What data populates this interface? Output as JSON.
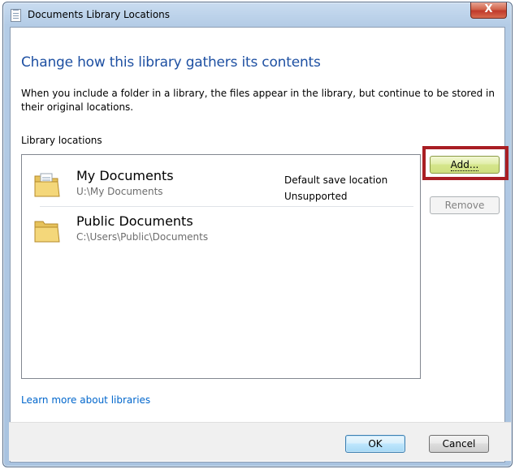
{
  "window": {
    "title": "Documents Library Locations",
    "close_label": "X"
  },
  "heading": "Change how this library gathers its contents",
  "description": "When you include a folder in a library, the files appear in the library, but continue to be stored in their original locations.",
  "section_label": "Library locations",
  "locations": [
    {
      "name": "My Documents",
      "path": "U:\\My Documents",
      "status_line1": "Default save location",
      "status_line2": "Unsupported",
      "icon": "documents-folder-icon"
    },
    {
      "name": "Public Documents",
      "path": "C:\\Users\\Public\\Documents",
      "icon": "folder-icon"
    }
  ],
  "buttons": {
    "add": "Add...",
    "remove": "Remove",
    "ok": "OK",
    "cancel": "Cancel"
  },
  "learn_more_link": "Learn more about libraries",
  "colors": {
    "heading": "#1e50a2",
    "link": "#0066cc",
    "highlight_box": "#a91e24"
  }
}
